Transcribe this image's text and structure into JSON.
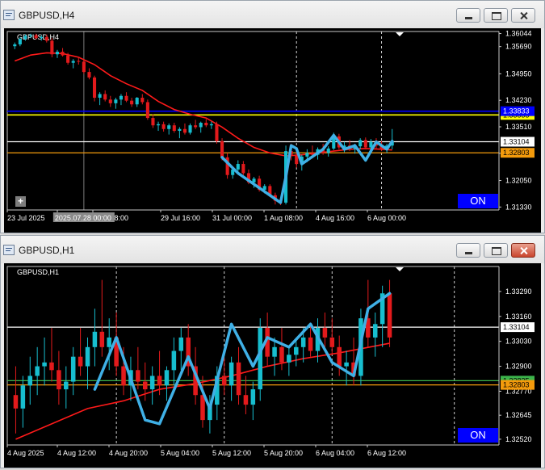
{
  "windows": [
    {
      "id": "h4",
      "title": "GBPUSD,H4",
      "label": "GBPUSD,H4",
      "price_labels": [
        "1.36044",
        "1.35690",
        "1.34950",
        "1.34230",
        "1.33510",
        "1.32790",
        "1.32050",
        "1.31330"
      ],
      "tags": [
        {
          "text": "1.33104",
          "value": 1.33104,
          "bg": "#ffffff",
          "fg": "#000000"
        },
        {
          "text": "1.32803",
          "value": 1.32803,
          "bg": "#f49b0c",
          "fg": "#000000"
        },
        {
          "text": "1.33833",
          "value": 1.33833,
          "bg": "#ffff00",
          "fg": "#000000"
        },
        {
          "text": "1.33833",
          "value": 1.33935,
          "bg": "#0000ff",
          "fg": "#ffffff"
        }
      ],
      "time_labels": [
        "23 Jul 2025",
        "25",
        "1 Jul 08:00",
        "29 Jul 16:00",
        "31 Jul 00:00",
        "1 Aug 08:00",
        "4 Aug 16:00",
        "6 Aug 00:00"
      ],
      "crosshair_label": "2025.07.28 00:00",
      "on_label": "ON",
      "add_label": "+"
    },
    {
      "id": "h1",
      "title": "GBPUSD,H1",
      "label": "GBPUSD,H1",
      "price_labels": [
        "1.33290",
        "1.33160",
        "1.33030",
        "1.32900",
        "1.32770",
        "1.32645",
        "1.32520"
      ],
      "tags": [
        {
          "text": "1.33104",
          "value": 1.33104,
          "bg": "#ffffff",
          "fg": "#000000"
        },
        {
          "text": "1.32825",
          "value": 1.32825,
          "bg": "#3cb44b",
          "fg": "#000000"
        },
        {
          "text": "1.32803",
          "value": 1.32803,
          "bg": "#f49b0c",
          "fg": "#000000"
        }
      ],
      "time_labels": [
        "4 Aug 2025",
        "4 Aug 12:00",
        "4 Aug 20:00",
        "5 Aug 04:00",
        "5 Aug 12:00",
        "5 Aug 20:00",
        "6 Aug 04:00",
        "6 Aug 12:00"
      ],
      "on_label": "ON"
    }
  ],
  "colors": {
    "bull": "#17becf",
    "bear": "#e31a1c",
    "ma": "#ff1a1a",
    "zigzag": "#3fb0e6",
    "grid": "#c8c8c8"
  },
  "chart_data": [
    {
      "type": "candlestick",
      "symbol": "GBPUSD",
      "timeframe": "H4",
      "ylim": [
        1.3125,
        1.361
      ],
      "x_labels": [
        "23 Jul 2025",
        "25",
        "1 Jul 08:00",
        "29 Jul 16:00",
        "31 Jul 00:00",
        "1 Aug 08:00",
        "4 Aug 16:00",
        "6 Aug 00:00"
      ],
      "horizontal_lines": [
        {
          "price": 1.33935,
          "color": "#0000ff"
        },
        {
          "price": 1.33833,
          "color": "#ffff00"
        },
        {
          "price": 1.33104,
          "color": "#ffffff"
        },
        {
          "price": 1.32803,
          "color": "#f49b0c"
        }
      ],
      "candles": [
        [
          1.357,
          1.358,
          1.3562,
          1.3575
        ],
        [
          1.3575,
          1.3595,
          1.357,
          1.359
        ],
        [
          1.359,
          1.3602,
          1.3585,
          1.3598
        ],
        [
          1.3598,
          1.3604,
          1.3592,
          1.36
        ],
        [
          1.36,
          1.3604,
          1.3588,
          1.3592
        ],
        [
          1.3592,
          1.36,
          1.3585,
          1.3595
        ],
        [
          1.3595,
          1.3602,
          1.358,
          1.3585
        ],
        [
          1.3585,
          1.3592,
          1.354,
          1.3548
        ],
        [
          1.3548,
          1.356,
          1.3538,
          1.3555
        ],
        [
          1.3555,
          1.3565,
          1.3542,
          1.3545
        ],
        [
          1.3545,
          1.3552,
          1.352,
          1.3525
        ],
        [
          1.3525,
          1.3535,
          1.351,
          1.353
        ],
        [
          1.353,
          1.354,
          1.352,
          1.3528
        ],
        [
          1.3528,
          1.3532,
          1.3495,
          1.35
        ],
        [
          1.35,
          1.351,
          1.348,
          1.3485
        ],
        [
          1.3485,
          1.349,
          1.342,
          1.343
        ],
        [
          1.343,
          1.3445,
          1.341,
          1.344
        ],
        [
          1.344,
          1.345,
          1.342,
          1.3425
        ],
        [
          1.3425,
          1.3435,
          1.3405,
          1.3415
        ],
        [
          1.3415,
          1.343,
          1.34,
          1.3425
        ],
        [
          1.3425,
          1.344,
          1.341,
          1.3435
        ],
        [
          1.3435,
          1.3445,
          1.3418,
          1.3422
        ],
        [
          1.3422,
          1.343,
          1.3405,
          1.3412
        ],
        [
          1.3412,
          1.3432,
          1.3405,
          1.343
        ],
        [
          1.343,
          1.344,
          1.3412,
          1.3418
        ],
        [
          1.3418,
          1.3425,
          1.337,
          1.3375
        ],
        [
          1.3375,
          1.3385,
          1.3348,
          1.3355
        ],
        [
          1.3355,
          1.3365,
          1.334,
          1.3358
        ],
        [
          1.3358,
          1.3365,
          1.3338,
          1.3345
        ],
        [
          1.3345,
          1.336,
          1.333,
          1.3355
        ],
        [
          1.3355,
          1.3362,
          1.3335,
          1.334
        ],
        [
          1.334,
          1.335,
          1.332,
          1.3345
        ],
        [
          1.3345,
          1.336,
          1.333,
          1.3335
        ],
        [
          1.3335,
          1.336,
          1.333,
          1.3355
        ],
        [
          1.3355,
          1.337,
          1.3345,
          1.335
        ],
        [
          1.335,
          1.3365,
          1.3335,
          1.3362
        ],
        [
          1.3362,
          1.3372,
          1.335,
          1.3355
        ],
        [
          1.3355,
          1.3365,
          1.3345,
          1.3358
        ],
        [
          1.3358,
          1.3365,
          1.3305,
          1.3312
        ],
        [
          1.3312,
          1.332,
          1.326,
          1.3268
        ],
        [
          1.3268,
          1.328,
          1.321,
          1.322
        ],
        [
          1.322,
          1.324,
          1.321,
          1.3235
        ],
        [
          1.3235,
          1.326,
          1.3225,
          1.325
        ],
        [
          1.325,
          1.3258,
          1.322,
          1.3225
        ],
        [
          1.3225,
          1.3235,
          1.3195,
          1.32
        ],
        [
          1.32,
          1.3215,
          1.3185,
          1.321
        ],
        [
          1.321,
          1.3218,
          1.3175,
          1.318
        ],
        [
          1.318,
          1.3195,
          1.317,
          1.319
        ],
        [
          1.319,
          1.3195,
          1.316,
          1.3165
        ],
        [
          1.3165,
          1.3172,
          1.314,
          1.315
        ],
        [
          1.315,
          1.3158,
          1.3138,
          1.3145
        ],
        [
          1.3145,
          1.33,
          1.314,
          1.3285
        ],
        [
          1.3285,
          1.3305,
          1.326,
          1.3275
        ],
        [
          1.3275,
          1.329,
          1.324,
          1.325
        ],
        [
          1.325,
          1.3275,
          1.3232,
          1.327
        ],
        [
          1.327,
          1.329,
          1.3255,
          1.328
        ],
        [
          1.328,
          1.33,
          1.3268,
          1.3275
        ],
        [
          1.3275,
          1.3295,
          1.3262,
          1.329
        ],
        [
          1.329,
          1.3305,
          1.3275,
          1.328
        ],
        [
          1.328,
          1.3298,
          1.327,
          1.3292
        ],
        [
          1.3292,
          1.3335,
          1.3288,
          1.3325
        ],
        [
          1.3325,
          1.3332,
          1.329,
          1.3295
        ],
        [
          1.3295,
          1.331,
          1.3282,
          1.33
        ],
        [
          1.33,
          1.3315,
          1.3285,
          1.329
        ],
        [
          1.329,
          1.3305,
          1.3278,
          1.3298
        ],
        [
          1.3298,
          1.332,
          1.329,
          1.3315
        ],
        [
          1.3315,
          1.3322,
          1.329,
          1.3295
        ],
        [
          1.3295,
          1.3318,
          1.3285,
          1.331
        ],
        [
          1.331,
          1.332,
          1.329,
          1.33
        ],
        [
          1.33,
          1.3312,
          1.3285,
          1.329
        ],
        [
          1.329,
          1.3305,
          1.328,
          1.33
        ],
        [
          1.33,
          1.3345,
          1.329,
          1.3312
        ]
      ],
      "ma": [
        [
          0,
          1.353
        ],
        [
          3,
          1.3546
        ],
        [
          6,
          1.3552
        ],
        [
          9,
          1.355
        ],
        [
          12,
          1.354
        ],
        [
          15,
          1.352
        ],
        [
          18,
          1.349
        ],
        [
          21,
          1.3468
        ],
        [
          24,
          1.345
        ],
        [
          27,
          1.342
        ],
        [
          30,
          1.3398
        ],
        [
          33,
          1.3385
        ],
        [
          36,
          1.3375
        ],
        [
          39,
          1.335
        ],
        [
          42,
          1.332
        ],
        [
          45,
          1.3295
        ],
        [
          48,
          1.328
        ],
        [
          51,
          1.3272
        ],
        [
          54,
          1.3275
        ],
        [
          57,
          1.328
        ],
        [
          60,
          1.3285
        ],
        [
          63,
          1.329
        ],
        [
          66,
          1.3292
        ],
        [
          69,
          1.329
        ],
        [
          71,
          1.3288
        ]
      ],
      "zigzag": [
        [
          39,
          1.3268
        ],
        [
          42,
          1.3225
        ],
        [
          45,
          1.3195
        ],
        [
          48,
          1.3165
        ],
        [
          50,
          1.3145
        ],
        [
          51,
          1.3215
        ],
        [
          52,
          1.33
        ],
        [
          53,
          1.3292
        ],
        [
          54,
          1.325
        ],
        [
          56,
          1.327
        ],
        [
          58,
          1.329
        ],
        [
          60,
          1.3328
        ],
        [
          62,
          1.329
        ],
        [
          64,
          1.33
        ],
        [
          66,
          1.326
        ],
        [
          68,
          1.331
        ],
        [
          70,
          1.329
        ],
        [
          71,
          1.3312
        ]
      ],
      "vertical_lines": [
        13,
        53,
        69
      ]
    },
    {
      "type": "candlestick",
      "symbol": "GBPUSD",
      "timeframe": "H1",
      "ylim": [
        1.3249,
        1.3342
      ],
      "x_labels": [
        "4 Aug 2025",
        "4 Aug 12:00",
        "4 Aug 20:00",
        "5 Aug 04:00",
        "5 Aug 12:00",
        "5 Aug 20:00",
        "6 Aug 04:00",
        "6 Aug 12:00"
      ],
      "horizontal_lines": [
        {
          "price": 1.33104,
          "color": "#ffffff"
        },
        {
          "price": 1.32825,
          "color": "#3cb44b"
        },
        {
          "price": 1.32803,
          "color": "#f49b0c"
        }
      ],
      "candles": [
        [
          1.3275,
          1.329,
          1.3255,
          1.3268
        ],
        [
          1.3268,
          1.3285,
          1.3258,
          1.328
        ],
        [
          1.328,
          1.3295,
          1.327,
          1.3285
        ],
        [
          1.3285,
          1.33,
          1.3275,
          1.329
        ],
        [
          1.329,
          1.3305,
          1.328,
          1.3292
        ],
        [
          1.3292,
          1.331,
          1.3282,
          1.3288
        ],
        [
          1.3288,
          1.3298,
          1.327,
          1.3278
        ],
        [
          1.3278,
          1.329,
          1.3268,
          1.3282
        ],
        [
          1.3282,
          1.33,
          1.3275,
          1.3295
        ],
        [
          1.3295,
          1.331,
          1.3285,
          1.329
        ],
        [
          1.329,
          1.3305,
          1.3278,
          1.33
        ],
        [
          1.33,
          1.332,
          1.329,
          1.3308
        ],
        [
          1.3308,
          1.3335,
          1.3295,
          1.33
        ],
        [
          1.33,
          1.3315,
          1.3288,
          1.3305
        ],
        [
          1.3305,
          1.3318,
          1.3285,
          1.329
        ],
        [
          1.329,
          1.33,
          1.3275,
          1.328
        ],
        [
          1.328,
          1.3295,
          1.3272,
          1.3288
        ],
        [
          1.3288,
          1.33,
          1.3278,
          1.3282
        ],
        [
          1.3282,
          1.3292,
          1.3272,
          1.3278
        ],
        [
          1.3278,
          1.329,
          1.327,
          1.3285
        ],
        [
          1.3285,
          1.3298,
          1.3275,
          1.328
        ],
        [
          1.328,
          1.329,
          1.3272,
          1.3288
        ],
        [
          1.3288,
          1.3305,
          1.328,
          1.3298
        ],
        [
          1.3298,
          1.331,
          1.3288,
          1.3305
        ],
        [
          1.3305,
          1.3312,
          1.3285,
          1.329
        ],
        [
          1.329,
          1.33,
          1.327,
          1.3275
        ],
        [
          1.3275,
          1.3285,
          1.3258,
          1.3262
        ],
        [
          1.3262,
          1.3275,
          1.3255,
          1.327
        ],
        [
          1.327,
          1.329,
          1.3262,
          1.3285
        ],
        [
          1.3285,
          1.3295,
          1.3275,
          1.328
        ],
        [
          1.328,
          1.3295,
          1.3272,
          1.3292
        ],
        [
          1.3292,
          1.33,
          1.327,
          1.3275
        ],
        [
          1.3275,
          1.3285,
          1.3265,
          1.327
        ],
        [
          1.327,
          1.3282,
          1.3262,
          1.3278
        ],
        [
          1.3278,
          1.3315,
          1.3272,
          1.331
        ],
        [
          1.331,
          1.3318,
          1.329,
          1.3295
        ],
        [
          1.3295,
          1.3305,
          1.3285,
          1.33
        ],
        [
          1.33,
          1.331,
          1.3288,
          1.3292
        ],
        [
          1.3292,
          1.33,
          1.3285,
          1.3296
        ],
        [
          1.3296,
          1.3305,
          1.329,
          1.33
        ],
        [
          1.33,
          1.331,
          1.3292,
          1.3305
        ],
        [
          1.3305,
          1.3312,
          1.3295,
          1.3298
        ],
        [
          1.3298,
          1.3315,
          1.3292,
          1.331
        ],
        [
          1.331,
          1.3318,
          1.33,
          1.3305
        ],
        [
          1.3305,
          1.3315,
          1.3296,
          1.33
        ],
        [
          1.33,
          1.3306,
          1.3285,
          1.329
        ],
        [
          1.329,
          1.3298,
          1.328,
          1.3292
        ],
        [
          1.3292,
          1.3305,
          1.328,
          1.3285
        ],
        [
          1.3285,
          1.332,
          1.328,
          1.3315
        ],
        [
          1.3315,
          1.3335,
          1.33,
          1.3305
        ],
        [
          1.3305,
          1.3318,
          1.3295,
          1.3312
        ],
        [
          1.3312,
          1.3332,
          1.33,
          1.3328
        ],
        [
          1.3328,
          1.3335,
          1.33,
          1.3305
        ]
      ],
      "ma": [
        [
          0,
          1.3252
        ],
        [
          5,
          1.326
        ],
        [
          10,
          1.3268
        ],
        [
          15,
          1.3272
        ],
        [
          20,
          1.3278
        ],
        [
          25,
          1.3281
        ],
        [
          30,
          1.3285
        ],
        [
          35,
          1.329
        ],
        [
          40,
          1.3294
        ],
        [
          45,
          1.3297
        ],
        [
          52,
          1.3302
        ]
      ],
      "zigzag": [
        [
          11,
          1.3278
        ],
        [
          14,
          1.3305
        ],
        [
          18,
          1.3262
        ],
        [
          20,
          1.326
        ],
        [
          24,
          1.3295
        ],
        [
          27,
          1.3268
        ],
        [
          30,
          1.3312
        ],
        [
          33,
          1.329
        ],
        [
          35,
          1.3305
        ],
        [
          38,
          1.33
        ],
        [
          41,
          1.3312
        ],
        [
          44,
          1.3292
        ],
        [
          47,
          1.3285
        ],
        [
          49,
          1.332
        ],
        [
          52,
          1.3328
        ]
      ],
      "vertical_lines": [
        14,
        29,
        44,
        61
      ]
    }
  ]
}
